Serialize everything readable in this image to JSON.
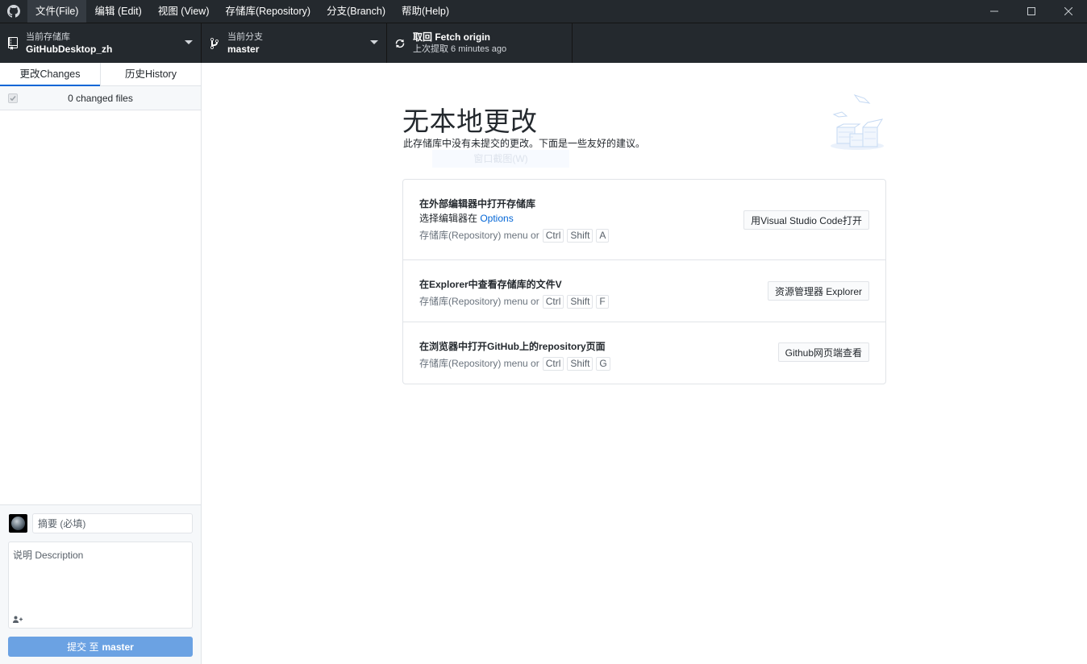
{
  "menubar": {
    "items": [
      {
        "label": "文件(File)",
        "active": true
      },
      {
        "label": "编辑 (Edit)"
      },
      {
        "label": "视图 (View)"
      },
      {
        "label": "存储库(Repository)"
      },
      {
        "label": "分支(Branch)"
      },
      {
        "label": "帮助(Help)"
      }
    ]
  },
  "toolbar": {
    "repository": {
      "label": "当前存储库",
      "value": "GitHubDesktop_zh",
      "icon": "repo-icon"
    },
    "branch": {
      "label": "当前分支",
      "value": "master",
      "icon": "git-branch-icon"
    },
    "fetch": {
      "label": "取回 Fetch origin",
      "sub": "上次提取 6 minutes ago",
      "icon": "sync-icon"
    }
  },
  "sidebar": {
    "tabs": [
      {
        "label": "更改Changes",
        "selected": true
      },
      {
        "label": "历史History",
        "selected": false
      }
    ],
    "changes_count": "0 changed files",
    "commit": {
      "summary_placeholder": "摘要 (必填)",
      "summary_value": "",
      "description_placeholder": "说明 Description",
      "description_value": "",
      "button_prefix": "提交 至",
      "button_branch": "master"
    }
  },
  "main": {
    "title": "无本地更改",
    "subtitle": "此存储库中没有未提交的更改。下面是一些友好的建议。",
    "ghost_tip": "窗口截图(W)",
    "actions": [
      {
        "title": "在外部编辑器中打开存储库",
        "desc_prefix": "选择编辑器在 ",
        "desc_link": "Options",
        "menu_text": "存储库(Repository) menu or",
        "keys": [
          "Ctrl",
          "Shift",
          "A"
        ],
        "button": "用Visual Studio Code打开"
      },
      {
        "title": "在Explorer中查看存储库的文件V",
        "menu_text": "存储库(Repository) menu or",
        "keys": [
          "Ctrl",
          "Shift",
          "F"
        ],
        "button": "资源管理器 Explorer"
      },
      {
        "title": "在浏览器中打开GitHub上的repository页面",
        "menu_text": "存储库(Repository) menu or",
        "keys": [
          "Ctrl",
          "Shift",
          "G"
        ],
        "button": "Github网页端查看"
      }
    ]
  },
  "colors": {
    "chrome_bg": "#24292e",
    "accent": "#0366d6",
    "commit_button": "#6ba2e3"
  }
}
